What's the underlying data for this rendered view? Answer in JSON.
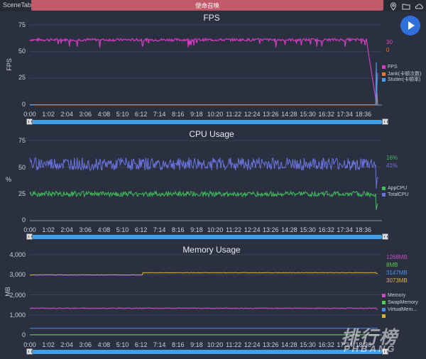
{
  "app": {
    "name": "SceneTab",
    "scene_title": "使命召唤"
  },
  "icons": {
    "location": "location-pin-icon",
    "folder": "folder-icon",
    "cloud": "cloud-icon",
    "play": "play-icon"
  },
  "colors": {
    "fps": "#d23dc0",
    "jank": "#e8782e",
    "stutter": "#4aa0f0",
    "app_cpu": "#3fbf58",
    "total_cpu": "#6b74e0",
    "memory": "#c849c0",
    "swap": "#5ac84a",
    "virtual": "#4a90e8",
    "yellow": "#d8b43c",
    "scroll": "#3ea0e8"
  },
  "x_ticks": [
    "0:00",
    "1:02",
    "2:04",
    "3:06",
    "4:08",
    "5:10",
    "6:12",
    "7:14",
    "8:16",
    "9:18",
    "10:20",
    "11:22",
    "12:24",
    "13:26",
    "14:28",
    "15:30",
    "16:32",
    "17:34",
    "18:36"
  ],
  "panels": {
    "fps": {
      "title": "FPS",
      "ylabel": "FPS",
      "y_ticks": [
        "75",
        "50",
        "25",
        "0"
      ],
      "current": [
        {
          "text": "30",
          "color": "#e04ab8"
        },
        {
          "text": "0",
          "color": "#e8782e"
        }
      ],
      "legend": [
        {
          "label": "FPS",
          "color": "#d23dc0"
        },
        {
          "label": "Jank(卡顿次数)",
          "color": "#e8782e"
        },
        {
          "label": "Stutter(卡顿率)",
          "color": "#4aa0f0"
        }
      ]
    },
    "cpu": {
      "title": "CPU Usage",
      "ylabel": "%",
      "y_ticks": [
        "75",
        "50",
        "25",
        "0"
      ],
      "current": [
        {
          "text": "16%",
          "color": "#3fbf58"
        },
        {
          "text": "41%",
          "color": "#6b74e0"
        }
      ],
      "legend": [
        {
          "label": "AppCPU",
          "color": "#3fbf58"
        },
        {
          "label": "TotalCPU",
          "color": "#6b74e0"
        }
      ]
    },
    "memory": {
      "title": "Memory Usage",
      "ylabel": "MB",
      "y_ticks": [
        "4,000",
        "3,000",
        "2,000",
        "1,000",
        "0"
      ],
      "current": [
        {
          "text": "1268MB",
          "color": "#c849c0"
        },
        {
          "text": "8MB",
          "color": "#5ac84a"
        },
        {
          "text": "3147MB",
          "color": "#4a90e8"
        },
        {
          "text": "3073MB",
          "color": "#d8b43c"
        }
      ],
      "legend": [
        {
          "label": "Memory",
          "color": "#c849c0"
        },
        {
          "label": "SwapMemory",
          "color": "#5ac84a"
        },
        {
          "label": "VirtualMem...",
          "color": "#4a90e8"
        },
        {
          "label": "",
          "color": "#d8b43c"
        }
      ]
    }
  },
  "chart_data": [
    {
      "type": "line",
      "title": "FPS",
      "ylabel": "FPS",
      "xlabel": "",
      "ylim": [
        0,
        75
      ],
      "series": [
        {
          "name": "FPS",
          "approx_level": 61,
          "end_drop_to": 5,
          "final": 30
        },
        {
          "name": "Jank(卡顿次数)",
          "final": 0
        },
        {
          "name": "Stutter(卡顿率)",
          "final": 0
        }
      ]
    },
    {
      "type": "line",
      "title": "CPU Usage",
      "ylabel": "%",
      "xlabel": "",
      "ylim": [
        0,
        75
      ],
      "series": [
        {
          "name": "AppCPU",
          "approx_level": 25,
          "final": 16
        },
        {
          "name": "TotalCPU",
          "approx_level": 53,
          "final": 41
        }
      ]
    },
    {
      "type": "line",
      "title": "Memory Usage",
      "ylabel": "MB",
      "xlabel": "",
      "ylim": [
        0,
        4000
      ],
      "series": [
        {
          "name": "Memory",
          "approx_level": 1330,
          "final": 1268
        },
        {
          "name": "SwapMemory",
          "approx_level": 8,
          "final": 8
        },
        {
          "name": "VirtualMem...",
          "approx_level": 330,
          "final": 3147
        },
        {
          "approx_level": 3040,
          "final": 3073
        }
      ]
    }
  ],
  "watermark": {
    "main": "排行榜",
    "sub": "PHBANG"
  }
}
